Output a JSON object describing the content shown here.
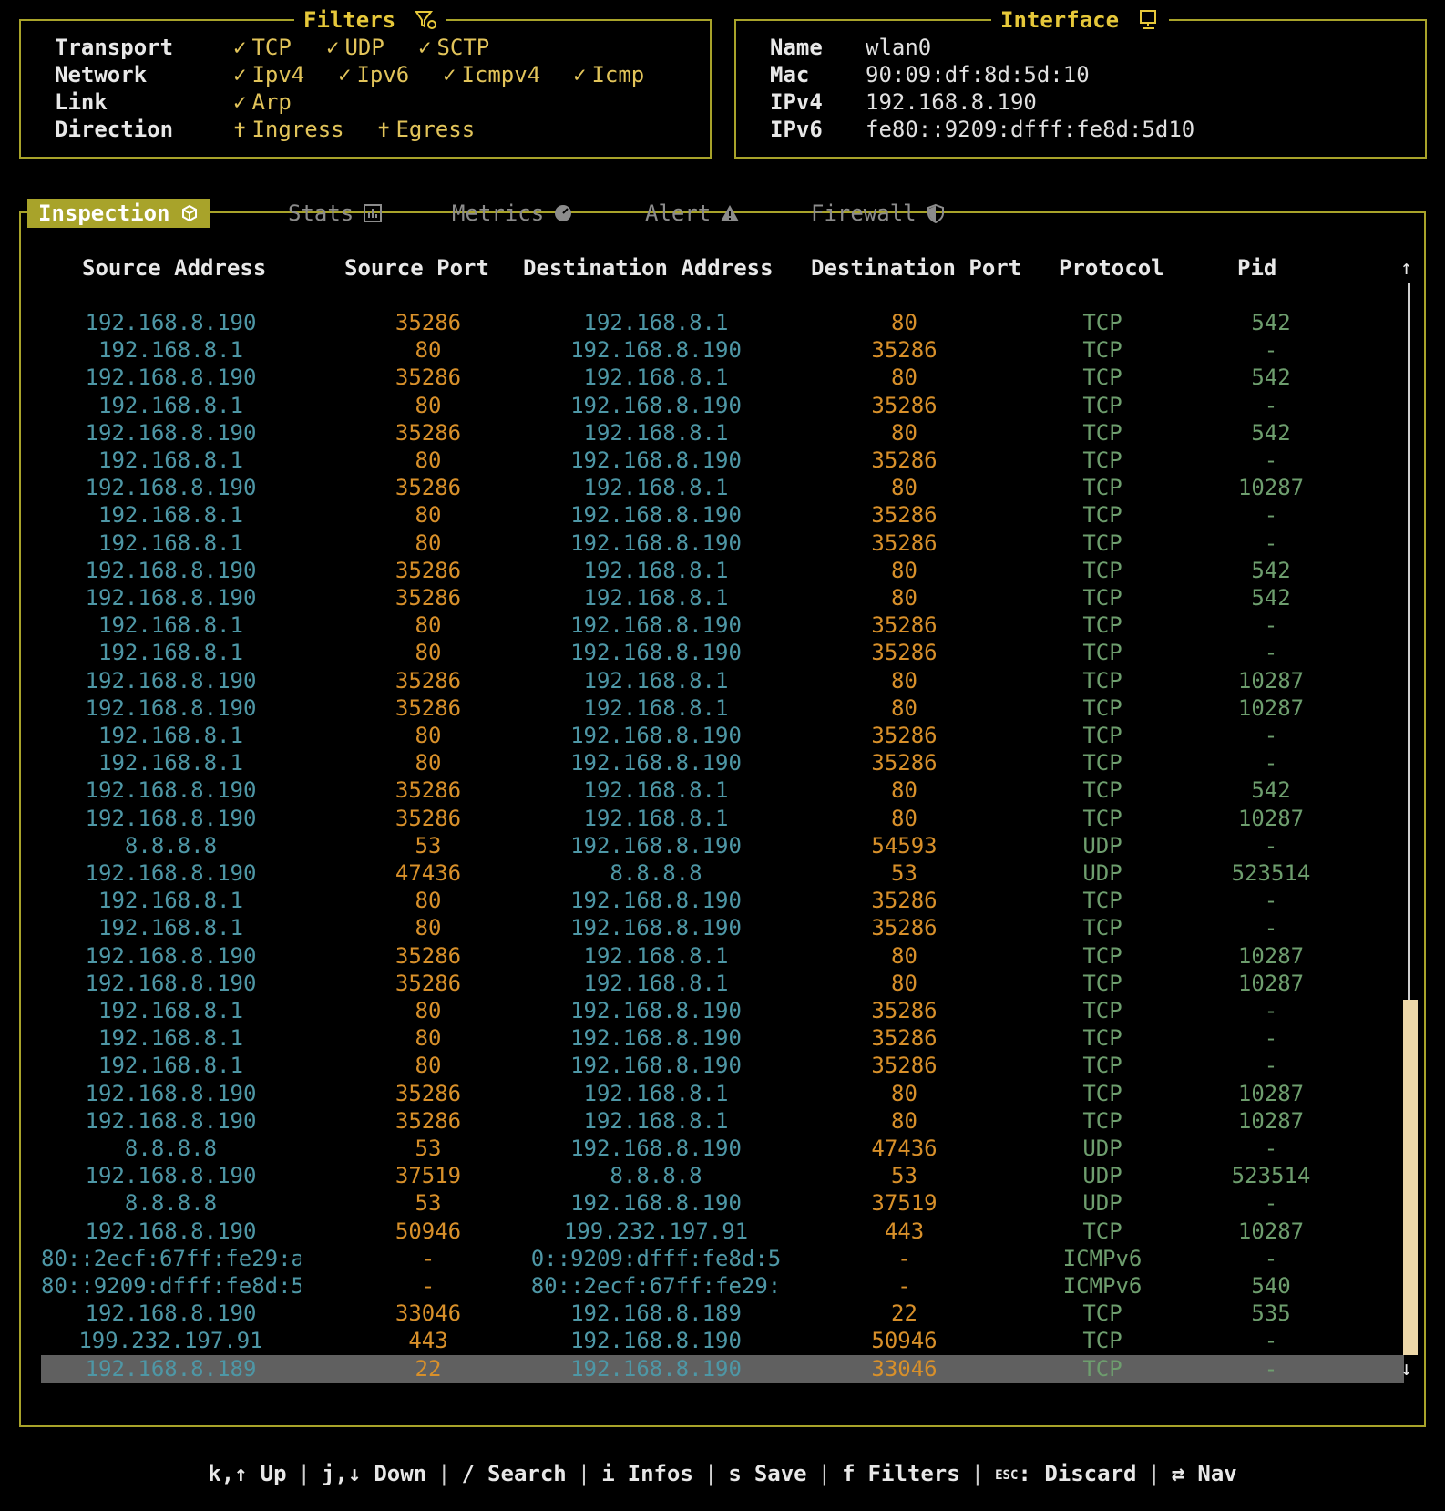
{
  "filters": {
    "title": "Filters",
    "icon": "filter-icon",
    "rows": [
      {
        "label": "Transport",
        "options": [
          "TCP",
          "UDP",
          "SCTP"
        ],
        "mark": "check"
      },
      {
        "label": "Network",
        "options": [
          "Ipv4",
          "Ipv6",
          "Icmpv4",
          "Icmp"
        ],
        "mark": "check"
      },
      {
        "label": "Link",
        "options": [
          "Arp"
        ],
        "mark": "check"
      },
      {
        "label": "Direction",
        "options": [
          "Ingress",
          "Egress"
        ],
        "mark": "pin"
      }
    ]
  },
  "interface": {
    "title": "Interface",
    "icon": "computer-icon",
    "rows": [
      {
        "label": "Name",
        "value": "wlan0"
      },
      {
        "label": "Mac",
        "value": "90:09:df:8d:5d:10"
      },
      {
        "label": "IPv4",
        "value": "192.168.8.190"
      },
      {
        "label": "IPv6",
        "value": "fe80::9209:dfff:fe8d:5d10"
      }
    ]
  },
  "tabs": [
    {
      "label": "Inspection",
      "icon": "package-icon",
      "active": true
    },
    {
      "label": "Stats",
      "icon": "bar-chart-icon",
      "active": false
    },
    {
      "label": "Metrics",
      "icon": "gauge-icon",
      "active": false
    },
    {
      "label": "Alert",
      "icon": "warning-icon",
      "active": false
    },
    {
      "label": "Firewall",
      "icon": "shield-icon",
      "active": false
    }
  ],
  "table": {
    "columns": [
      "Source Address",
      "Source Port",
      "Destination Address",
      "Destination Port",
      "Protocol",
      "Pid"
    ],
    "rows": [
      [
        "192.168.8.190",
        "35286",
        "192.168.8.1",
        "80",
        "TCP",
        "542"
      ],
      [
        "192.168.8.1",
        "80",
        "192.168.8.190",
        "35286",
        "TCP",
        "-"
      ],
      [
        "192.168.8.190",
        "35286",
        "192.168.8.1",
        "80",
        "TCP",
        "542"
      ],
      [
        "192.168.8.1",
        "80",
        "192.168.8.190",
        "35286",
        "TCP",
        "-"
      ],
      [
        "192.168.8.190",
        "35286",
        "192.168.8.1",
        "80",
        "TCP",
        "542"
      ],
      [
        "192.168.8.1",
        "80",
        "192.168.8.190",
        "35286",
        "TCP",
        "-"
      ],
      [
        "192.168.8.190",
        "35286",
        "192.168.8.1",
        "80",
        "TCP",
        "10287"
      ],
      [
        "192.168.8.1",
        "80",
        "192.168.8.190",
        "35286",
        "TCP",
        "-"
      ],
      [
        "192.168.8.1",
        "80",
        "192.168.8.190",
        "35286",
        "TCP",
        "-"
      ],
      [
        "192.168.8.190",
        "35286",
        "192.168.8.1",
        "80",
        "TCP",
        "542"
      ],
      [
        "192.168.8.190",
        "35286",
        "192.168.8.1",
        "80",
        "TCP",
        "542"
      ],
      [
        "192.168.8.1",
        "80",
        "192.168.8.190",
        "35286",
        "TCP",
        "-"
      ],
      [
        "192.168.8.1",
        "80",
        "192.168.8.190",
        "35286",
        "TCP",
        "-"
      ],
      [
        "192.168.8.190",
        "35286",
        "192.168.8.1",
        "80",
        "TCP",
        "10287"
      ],
      [
        "192.168.8.190",
        "35286",
        "192.168.8.1",
        "80",
        "TCP",
        "10287"
      ],
      [
        "192.168.8.1",
        "80",
        "192.168.8.190",
        "35286",
        "TCP",
        "-"
      ],
      [
        "192.168.8.1",
        "80",
        "192.168.8.190",
        "35286",
        "TCP",
        "-"
      ],
      [
        "192.168.8.190",
        "35286",
        "192.168.8.1",
        "80",
        "TCP",
        "542"
      ],
      [
        "192.168.8.190",
        "35286",
        "192.168.8.1",
        "80",
        "TCP",
        "10287"
      ],
      [
        "8.8.8.8",
        "53",
        "192.168.8.190",
        "54593",
        "UDP",
        "-"
      ],
      [
        "192.168.8.190",
        "47436",
        "8.8.8.8",
        "53",
        "UDP",
        "523514"
      ],
      [
        "192.168.8.1",
        "80",
        "192.168.8.190",
        "35286",
        "TCP",
        "-"
      ],
      [
        "192.168.8.1",
        "80",
        "192.168.8.190",
        "35286",
        "TCP",
        "-"
      ],
      [
        "192.168.8.190",
        "35286",
        "192.168.8.1",
        "80",
        "TCP",
        "10287"
      ],
      [
        "192.168.8.190",
        "35286",
        "192.168.8.1",
        "80",
        "TCP",
        "10287"
      ],
      [
        "192.168.8.1",
        "80",
        "192.168.8.190",
        "35286",
        "TCP",
        "-"
      ],
      [
        "192.168.8.1",
        "80",
        "192.168.8.190",
        "35286",
        "TCP",
        "-"
      ],
      [
        "192.168.8.1",
        "80",
        "192.168.8.190",
        "35286",
        "TCP",
        "-"
      ],
      [
        "192.168.8.190",
        "35286",
        "192.168.8.1",
        "80",
        "TCP",
        "10287"
      ],
      [
        "192.168.8.190",
        "35286",
        "192.168.8.1",
        "80",
        "TCP",
        "10287"
      ],
      [
        "8.8.8.8",
        "53",
        "192.168.8.190",
        "47436",
        "UDP",
        "-"
      ],
      [
        "192.168.8.190",
        "37519",
        "8.8.8.8",
        "53",
        "UDP",
        "523514"
      ],
      [
        "8.8.8.8",
        "53",
        "192.168.8.190",
        "37519",
        "UDP",
        "-"
      ],
      [
        "192.168.8.190",
        "50946",
        "199.232.197.91",
        "443",
        "TCP",
        "10287"
      ],
      [
        "80::2ecf:67ff:fe29:a",
        "-",
        "0::9209:dfff:fe8d:5",
        "-",
        "ICMPv6",
        "-"
      ],
      [
        "80::9209:dfff:fe8d:5",
        "-",
        "80::2ecf:67ff:fe29:",
        "-",
        "ICMPv6",
        "540"
      ],
      [
        "192.168.8.190",
        "33046",
        "192.168.8.189",
        "22",
        "TCP",
        "535"
      ],
      [
        "199.232.197.91",
        "443",
        "192.168.8.190",
        "50946",
        "TCP",
        "-"
      ],
      [
        "192.168.8.189",
        "22",
        "192.168.8.190",
        "33046",
        "TCP",
        "-"
      ]
    ],
    "selected_row": 38
  },
  "footer": [
    {
      "key": "k,↑",
      "action": "Up"
    },
    {
      "key": "j,↓",
      "action": "Down"
    },
    {
      "key": "/",
      "action": "Search"
    },
    {
      "key": "i",
      "action": "Infos"
    },
    {
      "key": "s",
      "action": "Save"
    },
    {
      "key": "f",
      "action": "Filters"
    },
    {
      "key": "ESC",
      "action": ": Discard"
    },
    {
      "key": "⇄",
      "action": "Nav"
    }
  ],
  "colors": {
    "border": "#a8a32a",
    "title": "#e6c83a",
    "address": "#4e97a6",
    "port": "#d8902a",
    "protocol": "#6e9e6e",
    "selection": "#606060"
  }
}
